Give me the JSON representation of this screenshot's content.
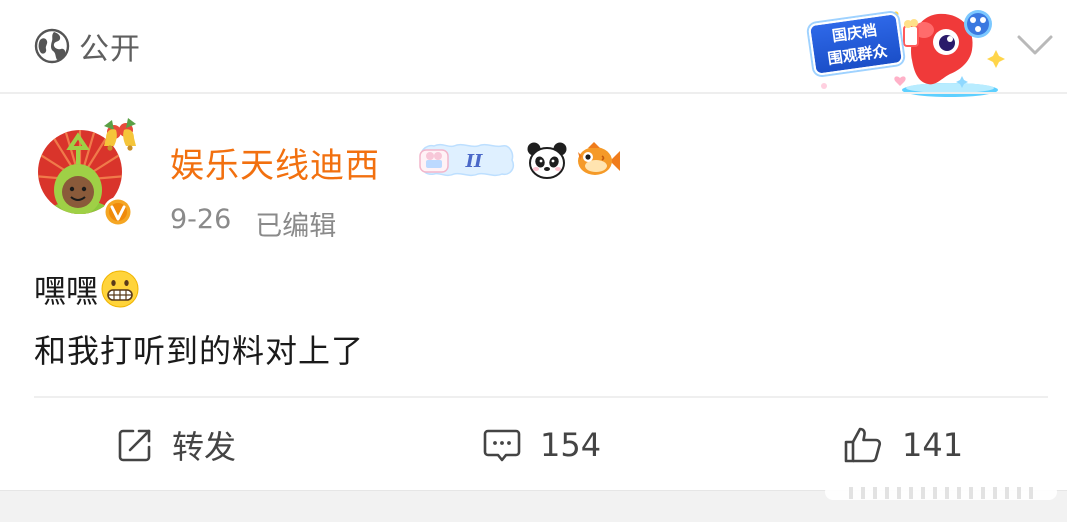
{
  "post_header": {
    "visibility_label": "公开",
    "visibility_icon": "globe-icon",
    "campaign_banner": [
      "国庆档",
      "围观群众"
    ],
    "expand_icon": "chevron-down-icon"
  },
  "author": {
    "name": "娱乐天线迪西",
    "name_color": "#f2700f",
    "verified_icon": "verified-v-icon",
    "badges": [
      "constellation-badge-icon",
      "panda-badge-icon",
      "fish-badge-icon"
    ],
    "constellation_badge_text": "II",
    "date": "9-26",
    "edited_label": "已编辑"
  },
  "post": {
    "line1": "嘿嘿",
    "emoji": "grimacing-face-icon",
    "line2": "和我打听到的料对上了"
  },
  "actions": {
    "repost_label": "转发",
    "comment_count": "154",
    "like_count": "141"
  },
  "colors": {
    "text": "#1a1a1a",
    "meta": "#8a8a8a",
    "divider": "#eeeeee"
  }
}
